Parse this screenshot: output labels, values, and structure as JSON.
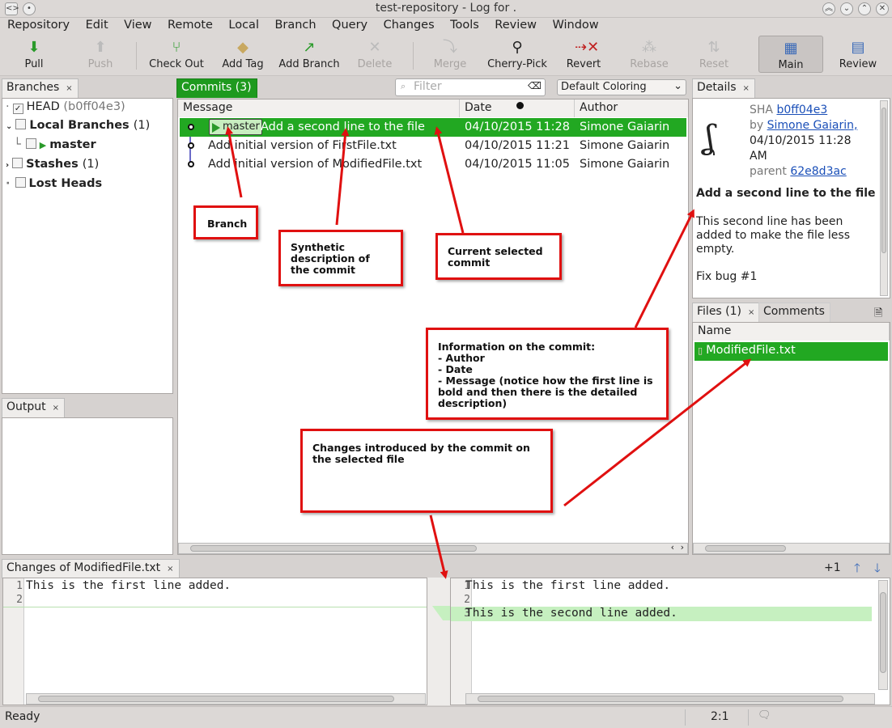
{
  "window": {
    "title": "test-repository - Log for ."
  },
  "menu": [
    "Repository",
    "Edit",
    "View",
    "Remote",
    "Local",
    "Branch",
    "Query",
    "Changes",
    "Tools",
    "Review",
    "Window"
  ],
  "toolbar": {
    "pull": "Pull",
    "push": "Push",
    "checkout": "Check Out",
    "add_tag": "Add Tag",
    "add_branch": "Add Branch",
    "delete": "Delete",
    "merge": "Merge",
    "cherry_pick": "Cherry-Pick",
    "revert": "Revert",
    "rebase": "Rebase",
    "reset": "Reset",
    "main": "Main",
    "review": "Review"
  },
  "branches_panel": {
    "tab": "Branches",
    "head": "HEAD",
    "head_sha": "(b0ff04e3)",
    "local": "Local Branches",
    "local_count": "(1)",
    "master": "master",
    "stashes": "Stashes",
    "stashes_count": "(1)",
    "lost": "Lost Heads"
  },
  "output_panel": {
    "tab": "Output"
  },
  "commits_panel": {
    "tab": "Commits (3)",
    "filter_placeholder": "Filter",
    "coloring": "Default Coloring",
    "columns": {
      "message": "Message",
      "date": "Date",
      "author": "Author"
    },
    "branch_tag": "master",
    "rows": [
      {
        "message": "Add a second line to the file",
        "date": "04/10/2015 11:28",
        "author": "Simone Gaiarin"
      },
      {
        "message": "Add initial version of FirstFile.txt",
        "date": "04/10/2015 11:21",
        "author": "Simone Gaiarin"
      },
      {
        "message": "Add initial version of ModifiedFile.txt",
        "date": "04/10/2015 11:05",
        "author": "Simone Gaiarin"
      }
    ]
  },
  "details_panel": {
    "tab": "Details",
    "sha_label": "SHA",
    "sha": "b0ff04e3",
    "by_label": "by",
    "author": "Simone Gaiarin,",
    "date_line1": "04/10/2015 11:28",
    "date_line2": "AM",
    "parent_label": "parent",
    "parent": "62e8d3ac",
    "subject": "Add a second line to the file",
    "body": "This second line has been added to make the file less empty.",
    "footer": "Fix bug #1"
  },
  "files_panel": {
    "tab": "Files (1)",
    "comments_tab": "Comments",
    "column": "Name",
    "file": "ModifiedFile.txt"
  },
  "changes_panel": {
    "tab": "Changes of ModifiedFile.txt",
    "counter": "+1",
    "left": {
      "lines": [
        "1",
        "2"
      ],
      "text": [
        "This is the first line added.",
        ""
      ]
    },
    "right": {
      "lines": [
        "1",
        "2",
        "3"
      ],
      "text": [
        "This is the first line added.",
        "",
        "This is the second line added."
      ]
    }
  },
  "status": {
    "text": "Ready",
    "position": "2:1"
  },
  "annotations": {
    "branch": "Branch",
    "synthetic": "Synthetic\ndescription of\nthe commit",
    "current": "Current selected\ncommit",
    "info": "Information on the commit:\n- Author\n- Date\n- Message (notice how the first line is\nbold and then there is the detailed\ndescription)",
    "changes": "Changes introduced by the commit on\nthe selected file"
  },
  "colors": {
    "selection": "#22a822",
    "annotation": "#e01010",
    "added_line": "#c6f0c0"
  }
}
